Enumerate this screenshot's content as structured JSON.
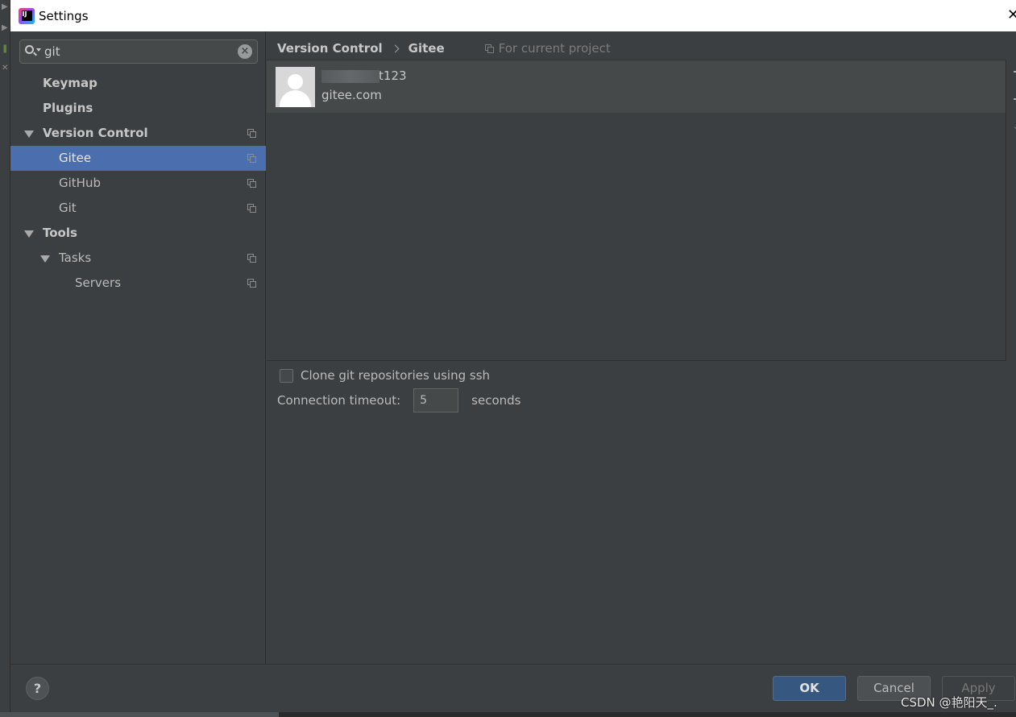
{
  "window": {
    "title": "Settings",
    "close": "✕"
  },
  "search": {
    "value": "git",
    "clear": "×"
  },
  "tree": {
    "items": [
      {
        "label": "Keymap"
      },
      {
        "label": "Plugins"
      },
      {
        "label": "Version Control"
      },
      {
        "label": "Gitee"
      },
      {
        "label": "GitHub"
      },
      {
        "label": "Git"
      },
      {
        "label": "Tools"
      },
      {
        "label": "Tasks"
      },
      {
        "label": "Servers"
      }
    ]
  },
  "breadcrumb": {
    "parent": "Version Control",
    "current": "Gitee",
    "scope": "For current project"
  },
  "account": {
    "name": "t123",
    "server": "gitee.com"
  },
  "options": {
    "clone_ssh_label": "Clone git repositories using ssh",
    "timeout_label": "Connection timeout:",
    "timeout_value": "5",
    "timeout_unit": "seconds"
  },
  "footer": {
    "help": "?",
    "ok": "OK",
    "cancel": "Cancel",
    "apply": "Apply"
  },
  "watermark": "CSDN @艳阳天_."
}
